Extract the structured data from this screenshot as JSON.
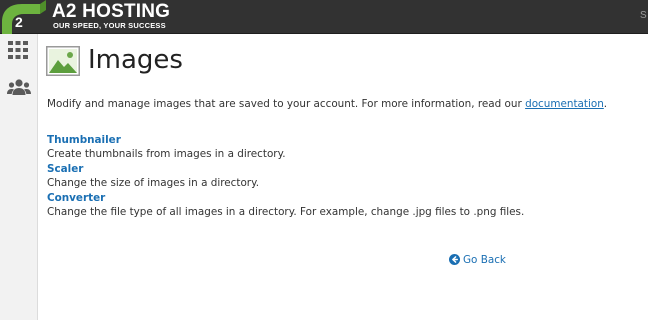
{
  "header": {
    "brand_name": "A2 HOSTING",
    "tagline": "OUR SPEED, YOUR SUCCESS",
    "search_hint": "S",
    "logo_icon": "a2-logo-icon",
    "colors": {
      "bar": "#323232",
      "logo_green": "#6db33f"
    }
  },
  "sidenav": {
    "items": [
      {
        "icon": "grid-apps-icon"
      },
      {
        "icon": "users-icon"
      }
    ]
  },
  "page": {
    "icon": "images-icon",
    "title": "Images",
    "intro_text": "Modify and manage images that are saved to your account. For more information, read our ",
    "intro_link": "documentation",
    "intro_suffix": "."
  },
  "tools": [
    {
      "name": "Thumbnailer",
      "description": "Create thumbnails from images in a directory."
    },
    {
      "name": "Scaler",
      "description": "Change the size of images in a directory."
    },
    {
      "name": "Converter",
      "description": "Change the file type of all images in a directory. For example, change .jpg files to .png files."
    }
  ],
  "go_back": {
    "icon": "arrow-left-circle-icon",
    "label": "Go Back"
  },
  "colors": {
    "link": "#1a6fb3",
    "text": "#333333"
  }
}
